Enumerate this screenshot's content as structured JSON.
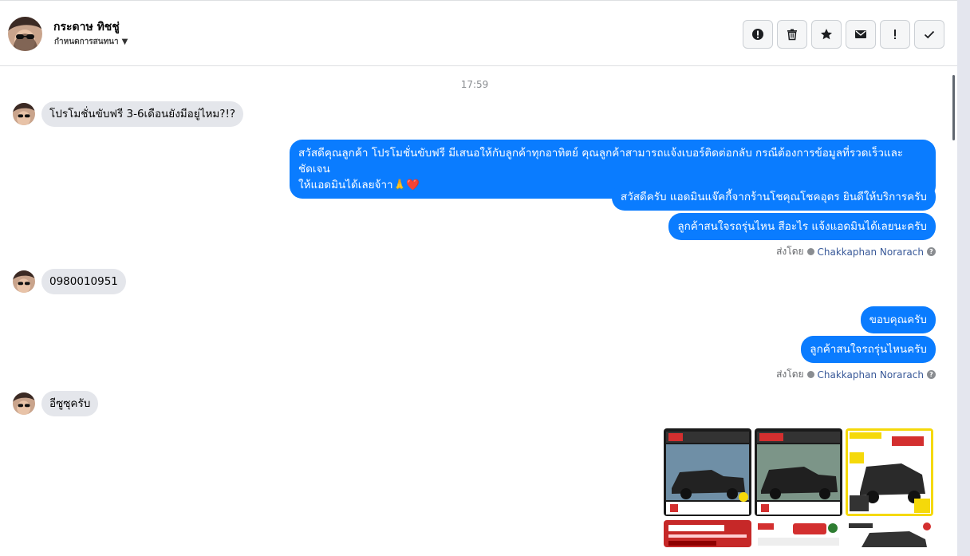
{
  "header": {
    "contact_name": "กระดาษ ทิชชู่",
    "subtitle": "กำหนดการสนทนา",
    "toolbar": [
      {
        "name": "report-button",
        "icon": "alert-circle-icon"
      },
      {
        "name": "delete-button",
        "icon": "trash-icon"
      },
      {
        "name": "star-button",
        "icon": "star-icon"
      },
      {
        "name": "mark-unread-button",
        "icon": "envelope-icon"
      },
      {
        "name": "spam-button",
        "icon": "exclamation-icon"
      },
      {
        "name": "done-button",
        "icon": "check-icon"
      }
    ]
  },
  "thread": {
    "timestamp": "17:59",
    "messages": [
      {
        "direction": "in",
        "text": "โปรโมชั่นขับฟรี 3-6เดือนยังมีอยู่ไหม?!?"
      },
      {
        "direction": "out",
        "text_line1": "สวัสดีคุณลูกค้า โปรโมชั่นขับฟรี มีเสนอให้กับลูกค้าทุกอาทิตย์ คุณลูกค้าสามารถแจ้งเบอร์ติดต่อกลับ กรณีต้องการข้อมูลที่รวดเร็วและชัดเจน",
        "text_line2": "ให้แอดมินได้เลยจ้าา🙏❤️"
      },
      {
        "direction": "out",
        "text": "สวัสดีครับ แอดมินแจ๊คกี้จากร้านโชคุณโชคอุดร ยินดีให้บริการครับ"
      },
      {
        "direction": "out",
        "text": "ลูกค้าสนใจรถรุ่นไหน สีอะไร แจ้งแอดมินได้เลยนะครับ"
      },
      {
        "direction": "in",
        "text": "0980010951"
      },
      {
        "direction": "out",
        "text": "ขอบคุณครับ"
      },
      {
        "direction": "out",
        "text": "ลูกค้าสนใจรถรุ่นไหนครับ"
      },
      {
        "direction": "in",
        "text": "อีซูซุครับ"
      }
    ],
    "sent_by_label": "ส่งโดย",
    "sent_by_agent": "Chakkaphan Norarach",
    "help_glyph": "?"
  },
  "gallery": {
    "images": [
      {
        "name": "car-ad-1",
        "bg": "#1a1a1a",
        "accent": "#d32f2f"
      },
      {
        "name": "car-ad-2",
        "bg": "#1a1a1a",
        "accent": "#d32f2f"
      },
      {
        "name": "car-ad-3",
        "bg": "#f5d90a",
        "accent": "#d32f2f"
      },
      {
        "name": "car-ad-4",
        "bg": "#c62828",
        "accent": "#ffffff"
      },
      {
        "name": "car-ad-5",
        "bg": "#ffffff",
        "accent": "#d32f2f"
      },
      {
        "name": "car-ad-6",
        "bg": "#ffffff",
        "accent": "#333333"
      }
    ]
  },
  "colors": {
    "outgoing_bubble": "#0a7cff",
    "incoming_bubble": "#e4e6eb",
    "agent_link": "#385898"
  }
}
